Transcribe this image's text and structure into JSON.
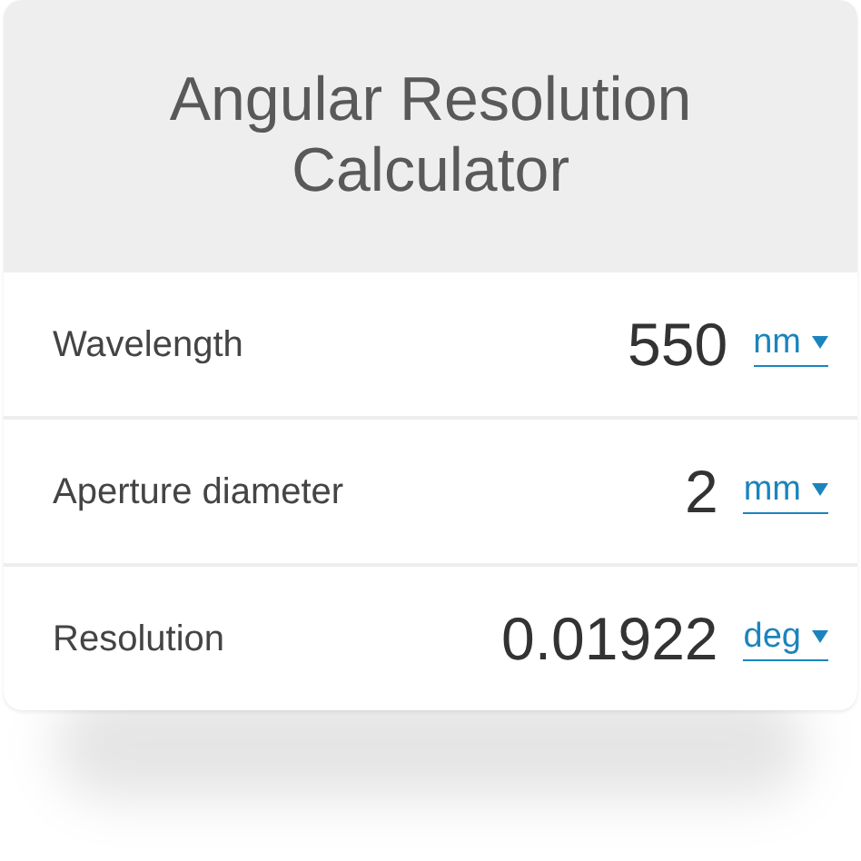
{
  "title": "Angular Resolution Calculator",
  "fields": [
    {
      "label": "Wavelength",
      "value": "550",
      "unit": "nm"
    },
    {
      "label": "Aperture diameter",
      "value": "2",
      "unit": "mm"
    },
    {
      "label": "Resolution",
      "value": "0.01922",
      "unit": "deg"
    }
  ]
}
